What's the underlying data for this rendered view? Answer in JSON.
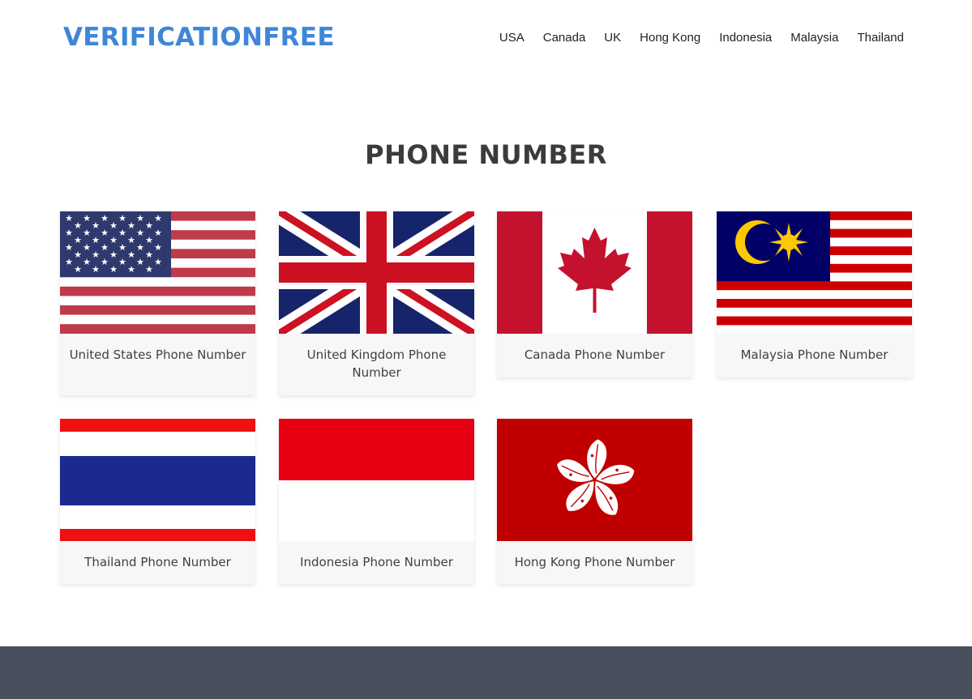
{
  "site": {
    "logo": "VERIFICATIONFREE"
  },
  "nav": {
    "items": [
      "USA",
      "Canada",
      "UK",
      "Hong Kong",
      "Indonesia",
      "Malaysia",
      "Thailand"
    ]
  },
  "main": {
    "title": "PHONE NUMBER"
  },
  "cards": [
    {
      "label": "United States Phone Number",
      "flag": "usa-flag-icon"
    },
    {
      "label": "United Kingdom Phone Number",
      "flag": "uk-flag-icon"
    },
    {
      "label": "Canada Phone Number",
      "flag": "canada-flag-icon"
    },
    {
      "label": "Malaysia Phone Number",
      "flag": "malaysia-flag-icon"
    },
    {
      "label": "Thailand Phone Number",
      "flag": "thailand-flag-icon"
    },
    {
      "label": "Indonesia Phone Number",
      "flag": "indonesia-flag-icon"
    },
    {
      "label": "Hong Kong Phone Number",
      "flag": "hong-kong-flag-icon"
    }
  ],
  "colors": {
    "logo": "#3f86d8",
    "footer": "#47505c",
    "card_bg": "#f7f7f7"
  }
}
